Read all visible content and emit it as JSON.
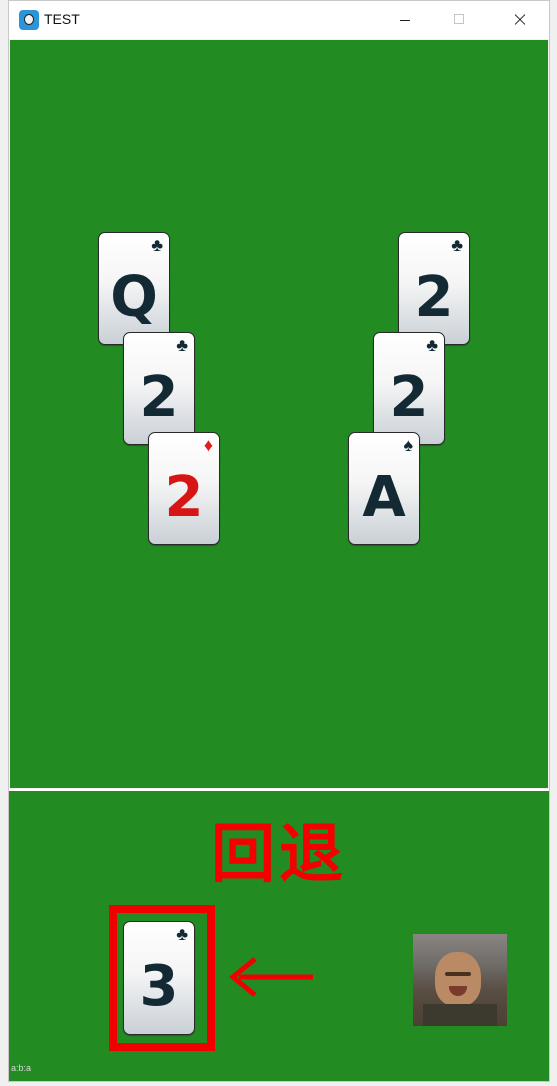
{
  "window": {
    "title": "TEST",
    "controls": {
      "minimize": "minimize",
      "maximize": "maximize",
      "close": "close"
    }
  },
  "tableau": {
    "left_pile": [
      {
        "rank": "Q",
        "suit": "♣",
        "color": "#132a35"
      },
      {
        "rank": "2",
        "suit": "♣",
        "color": "#132a35"
      },
      {
        "rank": "2",
        "suit": "♦",
        "color": "#d81515"
      }
    ],
    "right_pile": [
      {
        "rank": "2",
        "suit": "♣",
        "color": "#132a35"
      },
      {
        "rank": "2",
        "suit": "♣",
        "color": "#132a35"
      },
      {
        "rank": "A",
        "suit": "♠",
        "color": "#132a35"
      }
    ]
  },
  "bottom": {
    "undo_label": "回退",
    "held_card": {
      "rank": "3",
      "suit": "♣"
    },
    "arrow_icon": "left-arrow-icon",
    "avatar_icon": "meme-face-image",
    "corner_text": "a:b:a  "
  },
  "colors": {
    "felt": "#228b22",
    "accent_red": "#f00000"
  }
}
